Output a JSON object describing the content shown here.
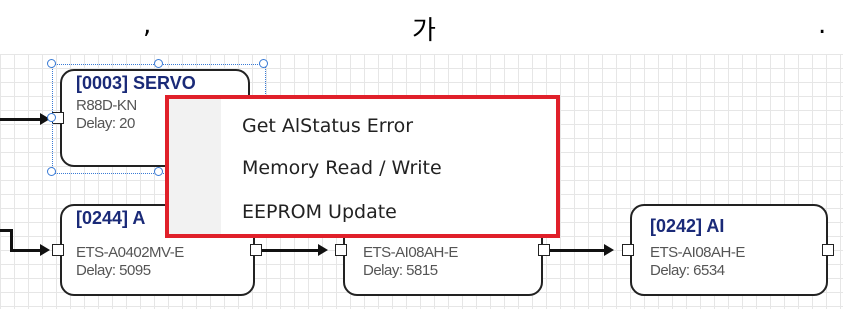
{
  "caption": {
    "part1": ",",
    "part2": "가",
    "part3": "."
  },
  "nodes": [
    {
      "title": "[0003] SERVO",
      "model": "R88D-KN",
      "delay": "Delay: 20"
    },
    {
      "title": "[0244] A",
      "model": "ETS-A0402MV-E",
      "delay": "Delay: 5095"
    },
    {
      "title": "",
      "model": "ETS-AI08AH-E",
      "delay": "Delay: 5815"
    },
    {
      "title": "[0242] AI",
      "model": "ETS-AI08AH-E",
      "delay": "Delay: 6534"
    }
  ],
  "context_menu": {
    "items": [
      "Get AlStatus Error",
      "Memory Read / Write",
      "EEPROM Update"
    ],
    "border_color": "#e0202a"
  }
}
